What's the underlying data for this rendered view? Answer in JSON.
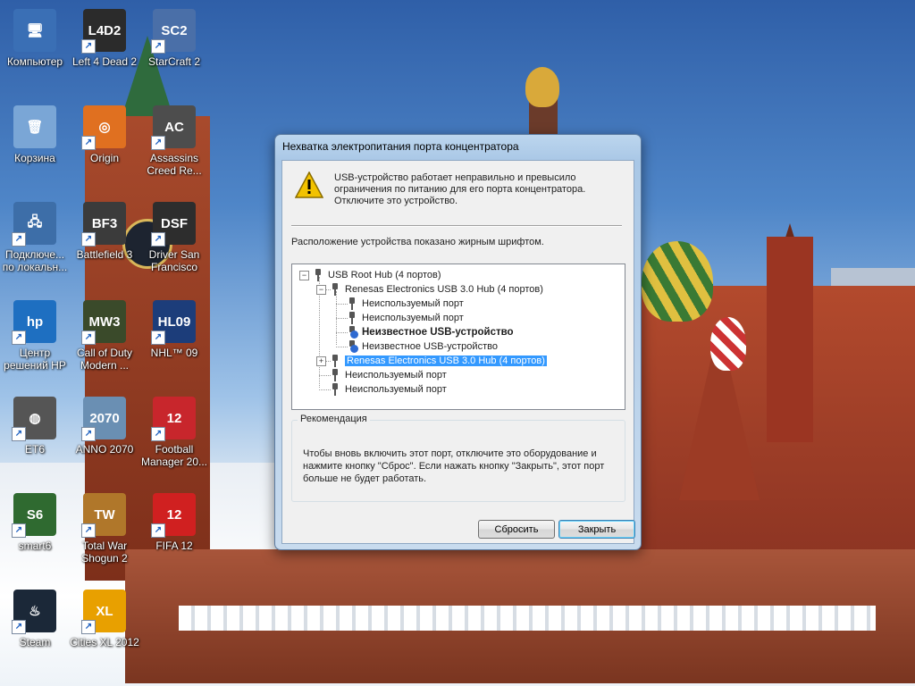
{
  "desktop": {
    "icons": [
      {
        "label": "Компьютер",
        "glyph": "🖥",
        "color": "#3a6fb5",
        "shortcut": false
      },
      {
        "label": "Left 4 Dead 2",
        "glyph": "L4D2",
        "color": "#2b2b2b",
        "shortcut": true
      },
      {
        "label": "StarCraft 2",
        "glyph": "SC2",
        "color": "#4a6fa8",
        "shortcut": true
      },
      {
        "label": "Корзина",
        "glyph": "🗑",
        "color": "#7aa6d6",
        "shortcut": false
      },
      {
        "label": "Origin",
        "glyph": "◎",
        "color": "#e07020",
        "shortcut": true
      },
      {
        "label": "Assassins Creed Re...",
        "glyph": "AC",
        "color": "#4d4d4d",
        "shortcut": true
      },
      {
        "label": "Подключе... по локальн...",
        "glyph": "🖧",
        "color": "#3d6ea8",
        "shortcut": true
      },
      {
        "label": "Battlefield 3",
        "glyph": "BF3",
        "color": "#3b3b3b",
        "shortcut": true
      },
      {
        "label": "Driver San Francisco",
        "glyph": "DSF",
        "color": "#2d2d2d",
        "shortcut": true
      },
      {
        "label": "Центр решений HP",
        "glyph": "hp",
        "color": "#1e6fc1",
        "shortcut": true
      },
      {
        "label": "Call of Duty Modern ...",
        "glyph": "MW3",
        "color": "#3a4a2a",
        "shortcut": true
      },
      {
        "label": "NHL™ 09",
        "glyph": "HL09",
        "color": "#1c3d7a",
        "shortcut": true
      },
      {
        "label": "ET6",
        "glyph": "◍",
        "color": "#555555",
        "shortcut": true
      },
      {
        "label": "ANNO 2070",
        "glyph": "2070",
        "color": "#6a8fb3",
        "shortcut": true
      },
      {
        "label": "Football Manager 20...",
        "glyph": "12",
        "color": "#c8262c",
        "shortcut": true
      },
      {
        "label": "smart6",
        "glyph": "S6",
        "color": "#2f6a30",
        "shortcut": true
      },
      {
        "label": "Total War Shogun 2",
        "glyph": "TW",
        "color": "#b0772a",
        "shortcut": true
      },
      {
        "label": "FIFA 12",
        "glyph": "12",
        "color": "#d02020",
        "shortcut": true
      },
      {
        "label": "Steam",
        "glyph": "♨",
        "color": "#1b2838",
        "shortcut": true
      },
      {
        "label": "Cities XL 2012",
        "glyph": "XL",
        "color": "#e8a000",
        "shortcut": true
      }
    ]
  },
  "dialog": {
    "title": "Нехватка электропитания порта концентратора",
    "warning_text": "USB-устройство работает неправильно и превысило ограничения по питанию для его порта концентратора. Отключите это устройство.",
    "hint": "Расположение устройства показано жирным шрифтом.",
    "tree": [
      {
        "label": "USB Root Hub (4 портов)",
        "level": 0,
        "expander": "−"
      },
      {
        "label": "Renesas Electronics USB 3.0 Hub (4 портов)",
        "level": 1,
        "expander": "−"
      },
      {
        "label": "Неиспользуемый порт",
        "level": 2
      },
      {
        "label": "Неиспользуемый порт",
        "level": 2
      },
      {
        "label": "Неизвестное USB-устройство",
        "level": 2,
        "bold": true,
        "question": true
      },
      {
        "label": "Неизвестное USB-устройство",
        "level": 2,
        "question": true
      },
      {
        "label": "Renesas Electronics USB 3.0 Hub (4 портов)",
        "level": 1,
        "expander": "+",
        "selected": true
      },
      {
        "label": "Неиспользуемый порт",
        "level": 1
      },
      {
        "label": "Неиспользуемый порт",
        "level": 1
      }
    ],
    "recommendation_title": "Рекомендация",
    "recommendation_text": "Чтобы вновь включить этот порт, отключите это оборудование и нажмите кнопку \"Сброс\". Если нажать кнопку \"Закрыть\", этот порт больше не будет работать.",
    "reset_label": "Сбросить",
    "close_label": "Закрыть"
  }
}
